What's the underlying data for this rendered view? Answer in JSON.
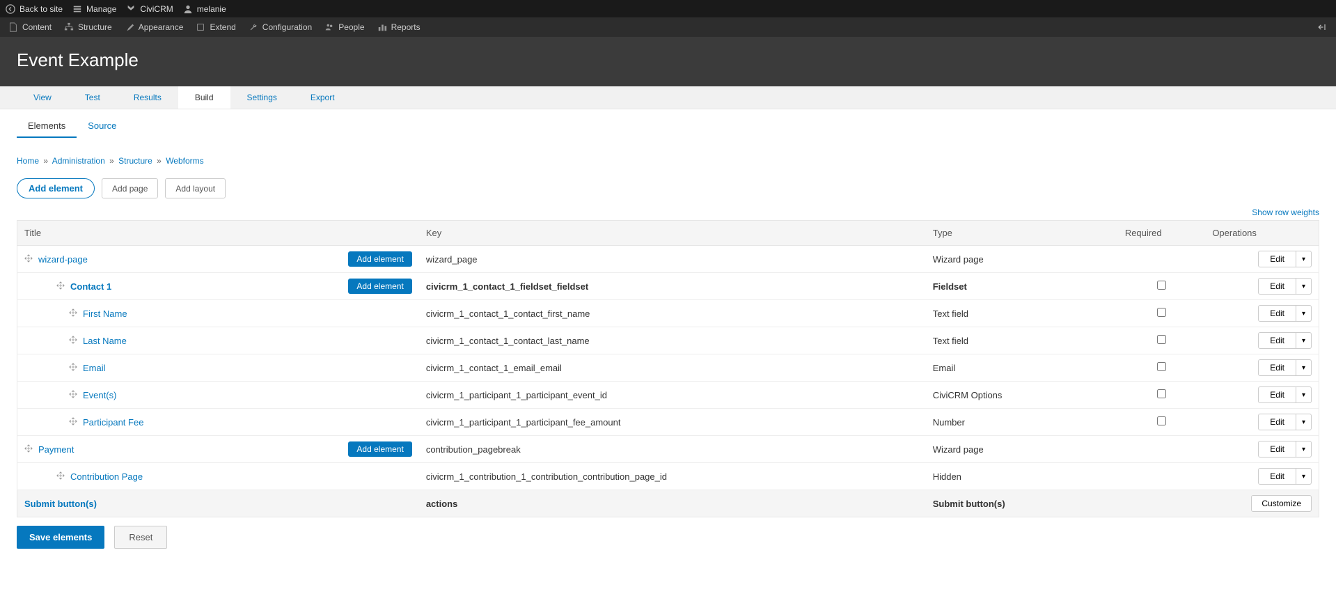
{
  "topbar": {
    "back": "Back to site",
    "manage": "Manage",
    "civicrm": "CiviCRM",
    "user": "melanie"
  },
  "adminmenu": {
    "content": "Content",
    "structure": "Structure",
    "appearance": "Appearance",
    "extend": "Extend",
    "configuration": "Configuration",
    "people": "People",
    "reports": "Reports"
  },
  "page_title": "Event Example",
  "primary_tabs": {
    "view": "View",
    "test": "Test",
    "results": "Results",
    "build": "Build",
    "settings": "Settings",
    "export": "Export"
  },
  "secondary_tabs": {
    "elements": "Elements",
    "source": "Source"
  },
  "breadcrumb": {
    "home": "Home",
    "administration": "Administration",
    "structure": "Structure",
    "webforms": "Webforms"
  },
  "action_row": {
    "add_element": "Add element",
    "add_page": "Add page",
    "add_layout": "Add layout"
  },
  "show_weights": "Show row weights",
  "table": {
    "headers": {
      "title": "Title",
      "key": "Key",
      "type": "Type",
      "required": "Required",
      "operations": "Operations"
    },
    "add_element_label": "Add element",
    "edit_label": "Edit",
    "customize_label": "Customize",
    "rows": [
      {
        "indent": 0,
        "title": "wizard-page",
        "key": "wizard_page",
        "type": "Wizard page",
        "add_btn": true,
        "checkbox": false
      },
      {
        "indent": 1,
        "title": "Contact 1",
        "bold": true,
        "key": "civicrm_1_contact_1_fieldset_fieldset",
        "key_bold": true,
        "type": "Fieldset",
        "type_bold": true,
        "add_btn": true,
        "checkbox": true
      },
      {
        "indent": 2,
        "title": "First Name",
        "key": "civicrm_1_contact_1_contact_first_name",
        "type": "Text field",
        "checkbox": true
      },
      {
        "indent": 2,
        "title": "Last Name",
        "key": "civicrm_1_contact_1_contact_last_name",
        "type": "Text field",
        "checkbox": true
      },
      {
        "indent": 2,
        "title": "Email",
        "key": "civicrm_1_contact_1_email_email",
        "type": "Email",
        "checkbox": true
      },
      {
        "indent": 2,
        "title": "Event(s)",
        "key": "civicrm_1_participant_1_participant_event_id",
        "type": "CiviCRM Options",
        "checkbox": true
      },
      {
        "indent": 2,
        "title": "Participant Fee",
        "key": "civicrm_1_participant_1_participant_fee_amount",
        "type": "Number",
        "checkbox": true
      },
      {
        "indent": 0,
        "title": "Payment",
        "key": "contribution_pagebreak",
        "type": "Wizard page",
        "add_btn": true,
        "checkbox": false
      },
      {
        "indent": 1,
        "title": "Contribution Page",
        "key": "civicrm_1_contribution_1_contribution_contribution_page_id",
        "type": "Hidden",
        "checkbox": false
      }
    ],
    "submit_row": {
      "title": "Submit button(s)",
      "key": "actions",
      "type": "Submit button(s)"
    }
  },
  "bottom": {
    "save": "Save elements",
    "reset": "Reset"
  }
}
